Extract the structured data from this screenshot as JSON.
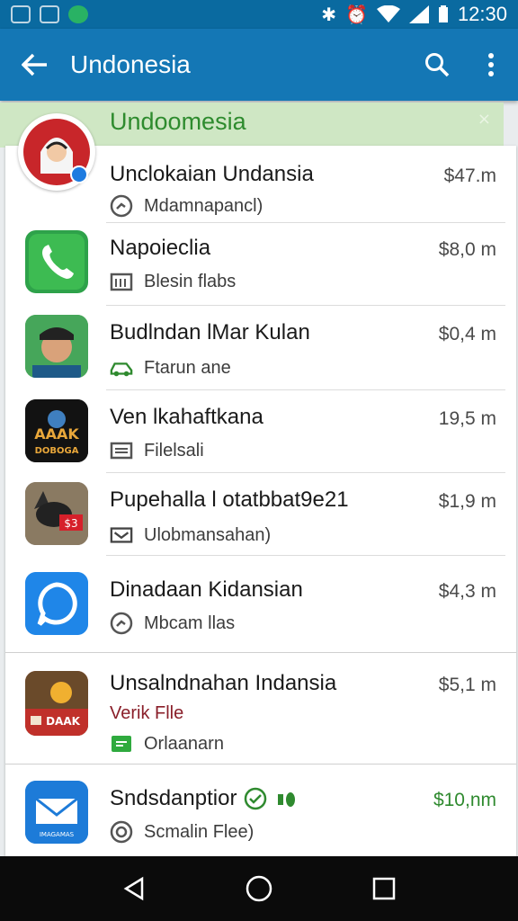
{
  "status_bar": {
    "time": "12:30"
  },
  "app_bar": {
    "title": "Undonesia"
  },
  "banner": {
    "text": "Undoomesia",
    "close_glyph": "×"
  },
  "items": [
    {
      "name": "Unclokaian Undansia",
      "price": "$47.m",
      "sub": "Mdamnapancl)",
      "icon": "gauge-icon"
    },
    {
      "name": "Napoieclia",
      "price": "$8,0 m",
      "sub": "Blesin flabs",
      "icon": "calendar-icon"
    },
    {
      "name": "Budlndan lMar Kulan",
      "price": "$0,4 m",
      "sub": "Ftarun ane",
      "icon": "car-icon"
    },
    {
      "name": "Ven lkahaftkana",
      "price": "19,5 m",
      "sub": "Filelsali",
      "icon": "list-icon"
    },
    {
      "name": "Pupehalla l otatbbat9e21",
      "price": "$1,9 m",
      "sub": "Ulobmansahan)",
      "icon": "mail-icon"
    },
    {
      "name": "Dinadaan Kidansian",
      "price": "$4,3 m",
      "sub": "Mbcam llas",
      "icon": "gauge-icon"
    },
    {
      "name": "Unsalndnahan Indansia",
      "price": "$5,1 m",
      "extra": "Verik Flle",
      "sub": "Orlaanarn",
      "icon": "list-green-icon"
    },
    {
      "name": "Sndsdanptior",
      "price": "$10,nm",
      "sub": "Scmalin Flee)",
      "icon": "target-icon"
    }
  ],
  "avatar_logos": {
    "row3": "AAAK\nDOBOGA",
    "row4": "$3",
    "row6": "DAAK",
    "row7": "IMAGAMAS"
  },
  "colors": {
    "appbar": "#1477b5",
    "statusbar": "#0a6aa0",
    "banner": "#cfe7c4",
    "banner_text": "#2e8b2e",
    "price_green": "#2f8a2f"
  }
}
